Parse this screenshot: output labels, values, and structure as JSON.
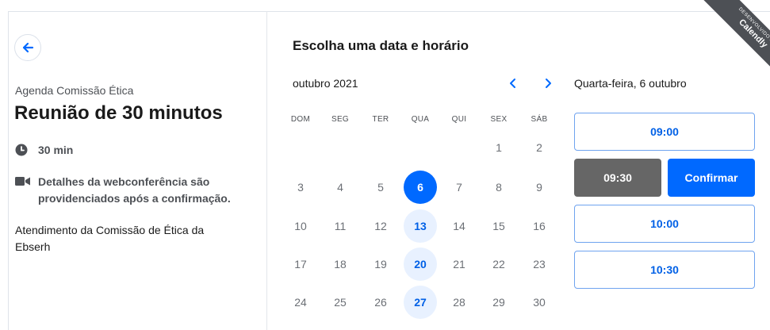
{
  "left_panel": {
    "back_icon": "arrow-left-icon",
    "organizer": "Agenda Comissão Ética",
    "event_title": "Reunião de 30 minutos",
    "duration": "30 min",
    "duration_icon": "clock-icon",
    "conference_line1": "Detalhes da webconferência são",
    "conference_line2": "providenciados após a confirmação.",
    "conference_icon": "video-camera-icon",
    "description_line1": "Atendimento da Comissão de Ética da",
    "description_line2": "Ebserh"
  },
  "calendar": {
    "heading": "Escolha uma data e horário",
    "month": "outubro 2021",
    "prev_icon": "chevron-left-icon",
    "next_icon": "chevron-right-icon",
    "weekdays": [
      "DOM",
      "SEG",
      "TER",
      "QUA",
      "QUI",
      "SEX",
      "SÁB"
    ],
    "weeks": [
      [
        "",
        "",
        "",
        "",
        "",
        "1",
        "2"
      ],
      [
        "3",
        "4",
        "5",
        "6",
        "7",
        "8",
        "9"
      ],
      [
        "10",
        "11",
        "12",
        "13",
        "14",
        "15",
        "16"
      ],
      [
        "17",
        "18",
        "19",
        "20",
        "21",
        "22",
        "23"
      ],
      [
        "24",
        "25",
        "26",
        "27",
        "28",
        "29",
        "30"
      ]
    ],
    "selected_day": "6",
    "available_days": [
      "6",
      "13",
      "20",
      "27"
    ]
  },
  "times": {
    "date_label": "Quarta-feira, 6 outubro",
    "slot_1": "09:00",
    "selected_slot": "09:30",
    "confirm_label": "Confirmar",
    "slot_3": "10:00",
    "slot_4": "10:30"
  },
  "badge": {
    "small_text": "DESENVOLVIDO POR",
    "brand": "Calendly"
  },
  "colors": {
    "accent": "#0069ff",
    "available_bg": "#e8f1ff",
    "selected_slot_bg": "#666666",
    "badge_bg": "#4d5055"
  }
}
